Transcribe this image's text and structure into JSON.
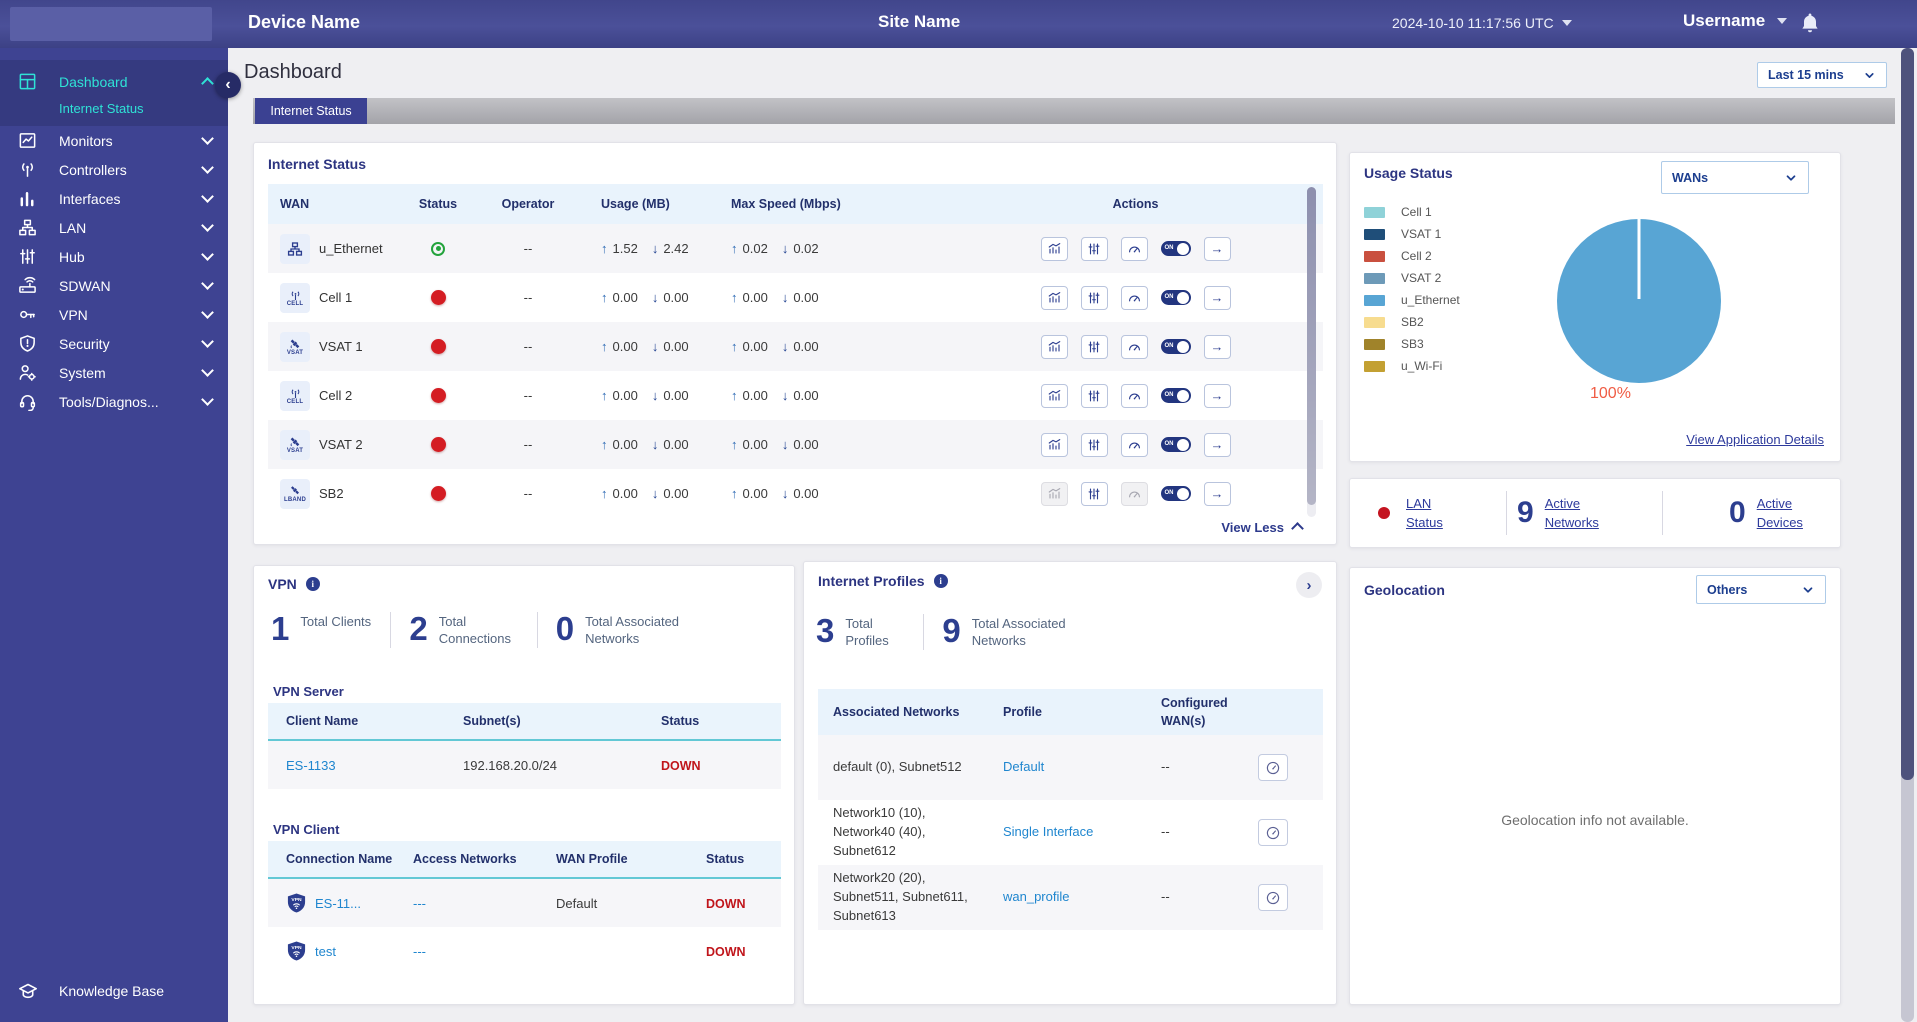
{
  "header": {
    "device_name": "Device Name",
    "site_name": "Site Name",
    "timestamp": "2024-10-10 11:17:56 UTC",
    "username": "Username"
  },
  "sidebar": {
    "items": [
      {
        "label": "Dashboard",
        "sub": [
          "Internet Status"
        ]
      },
      {
        "label": "Monitors"
      },
      {
        "label": "Controllers"
      },
      {
        "label": "Interfaces"
      },
      {
        "label": "LAN"
      },
      {
        "label": "Hub"
      },
      {
        "label": "SDWAN"
      },
      {
        "label": "VPN"
      },
      {
        "label": "Security"
      },
      {
        "label": "System"
      },
      {
        "label": "Tools/Diagnos..."
      }
    ],
    "knowledge_base": "Knowledge Base"
  },
  "page": {
    "title": "Dashboard",
    "time_filter": "Last 15 mins",
    "tab": "Internet Status"
  },
  "icons": {
    "up_arrow": "↑",
    "down_arrow": "↓",
    "forward_arrow": "→",
    "collapse": "‹",
    "expand": "›"
  },
  "internet_status": {
    "title": "Internet Status",
    "columns": [
      "WAN",
      "Status",
      "Operator",
      "Usage (MB)",
      "Max Speed (Mbps)",
      "Actions"
    ],
    "toggle_label": "ON",
    "view_less": "View Less",
    "rows": [
      {
        "name": "u_Ethernet",
        "badge": "",
        "status": "up",
        "operator": "--",
        "usage_up": "1.52",
        "usage_down": "2.42",
        "speed_up": "0.02",
        "speed_down": "0.02"
      },
      {
        "name": "Cell 1",
        "badge": "CELL",
        "status": "down",
        "operator": "--",
        "usage_up": "0.00",
        "usage_down": "0.00",
        "speed_up": "0.00",
        "speed_down": "0.00"
      },
      {
        "name": "VSAT 1",
        "badge": "VSAT",
        "status": "down",
        "operator": "--",
        "usage_up": "0.00",
        "usage_down": "0.00",
        "speed_up": "0.00",
        "speed_down": "0.00"
      },
      {
        "name": "Cell 2",
        "badge": "CELL",
        "status": "down",
        "operator": "--",
        "usage_up": "0.00",
        "usage_down": "0.00",
        "speed_up": "0.00",
        "speed_down": "0.00"
      },
      {
        "name": "VSAT 2",
        "badge": "VSAT",
        "status": "down",
        "operator": "--",
        "usage_up": "0.00",
        "usage_down": "0.00",
        "speed_up": "0.00",
        "speed_down": "0.00"
      },
      {
        "name": "SB2",
        "badge": "LBAND",
        "status": "down",
        "operator": "--",
        "usage_up": "0.00",
        "usage_down": "0.00",
        "speed_up": "0.00",
        "speed_down": "0.00"
      }
    ]
  },
  "vpn": {
    "title": "VPN",
    "stats": [
      {
        "value": "1",
        "label": "Total Clients"
      },
      {
        "value": "2",
        "label": "Total Connections"
      },
      {
        "value": "0",
        "label": "Total Associated Networks"
      }
    ],
    "server": {
      "title": "VPN Server",
      "columns": [
        "Client Name",
        "Subnet(s)",
        "Status"
      ],
      "rows": [
        {
          "client": "ES-1133",
          "subnets": "192.168.20.0/24",
          "status": "DOWN"
        }
      ]
    },
    "client": {
      "title": "VPN Client",
      "columns": [
        "Connection Name",
        "Access Networks",
        "WAN Profile",
        "Status"
      ],
      "rows": [
        {
          "name": "ES-11...",
          "access": "---",
          "profile": "Default",
          "status": "DOWN"
        },
        {
          "name": "test",
          "access": "---",
          "profile": "",
          "status": "DOWN"
        }
      ]
    }
  },
  "internet_profiles": {
    "title": "Internet Profiles",
    "stats": [
      {
        "value": "3",
        "label": "Total Profiles"
      },
      {
        "value": "9",
        "label": "Total Associated Networks"
      }
    ],
    "columns": [
      "Associated Networks",
      "Profile",
      "Configured WAN(s)"
    ],
    "rows": [
      {
        "networks": "default (0), Subnet512",
        "profile": "Default",
        "wans": "--"
      },
      {
        "networks": "Network10 (10), Network40 (40), Subnet612",
        "profile": "Single Interface",
        "wans": "--"
      },
      {
        "networks": "Network20 (20), Subnet511, Subnet611, Subnet613",
        "profile": "wan_profile",
        "wans": "--"
      }
    ]
  },
  "usage_status": {
    "title": "Usage Status",
    "filter": "WANs",
    "legend": [
      {
        "label": "Cell 1",
        "color": "#8fd2d8"
      },
      {
        "label": "VSAT 1",
        "color": "#1f4e79"
      },
      {
        "label": "Cell 2",
        "color": "#c9503f"
      },
      {
        "label": "VSAT 2",
        "color": "#6d9ab8"
      },
      {
        "label": "u_Ethernet",
        "color": "#58a5d4"
      },
      {
        "label": "SB2",
        "color": "#f7dc8f"
      },
      {
        "label": "SB3",
        "color": "#a0832a"
      },
      {
        "label": "u_Wi-Fi",
        "color": "#c3a032"
      }
    ],
    "chart_data": {
      "type": "pie",
      "labels": [
        "u_Ethernet"
      ],
      "values": [
        100
      ],
      "colors": [
        "#58a5d4"
      ],
      "annotation": "100%",
      "legend_position": "left"
    },
    "link": "View Application Details"
  },
  "lan_status": {
    "status_link": "LAN Status",
    "active_networks": {
      "value": "9",
      "label": "Active Networks"
    },
    "active_devices": {
      "value": "0",
      "label": "Active Devices"
    }
  },
  "geolocation": {
    "title": "Geolocation",
    "filter": "Others",
    "empty_message": "Geolocation info not available."
  },
  "colors": {
    "header_bg": "#414690",
    "sidebar_bg": "#3e4392",
    "active_cyan": "#2fe2d6",
    "accent_navy": "#2c3e8f",
    "link_blue": "#1f86cf",
    "status_down_red": "#c0151b",
    "status_dot_red": "#d41d23",
    "status_dot_green": "#23a33c",
    "pie_blue": "#58a5d4",
    "pie_label_color": "#f05c44"
  }
}
